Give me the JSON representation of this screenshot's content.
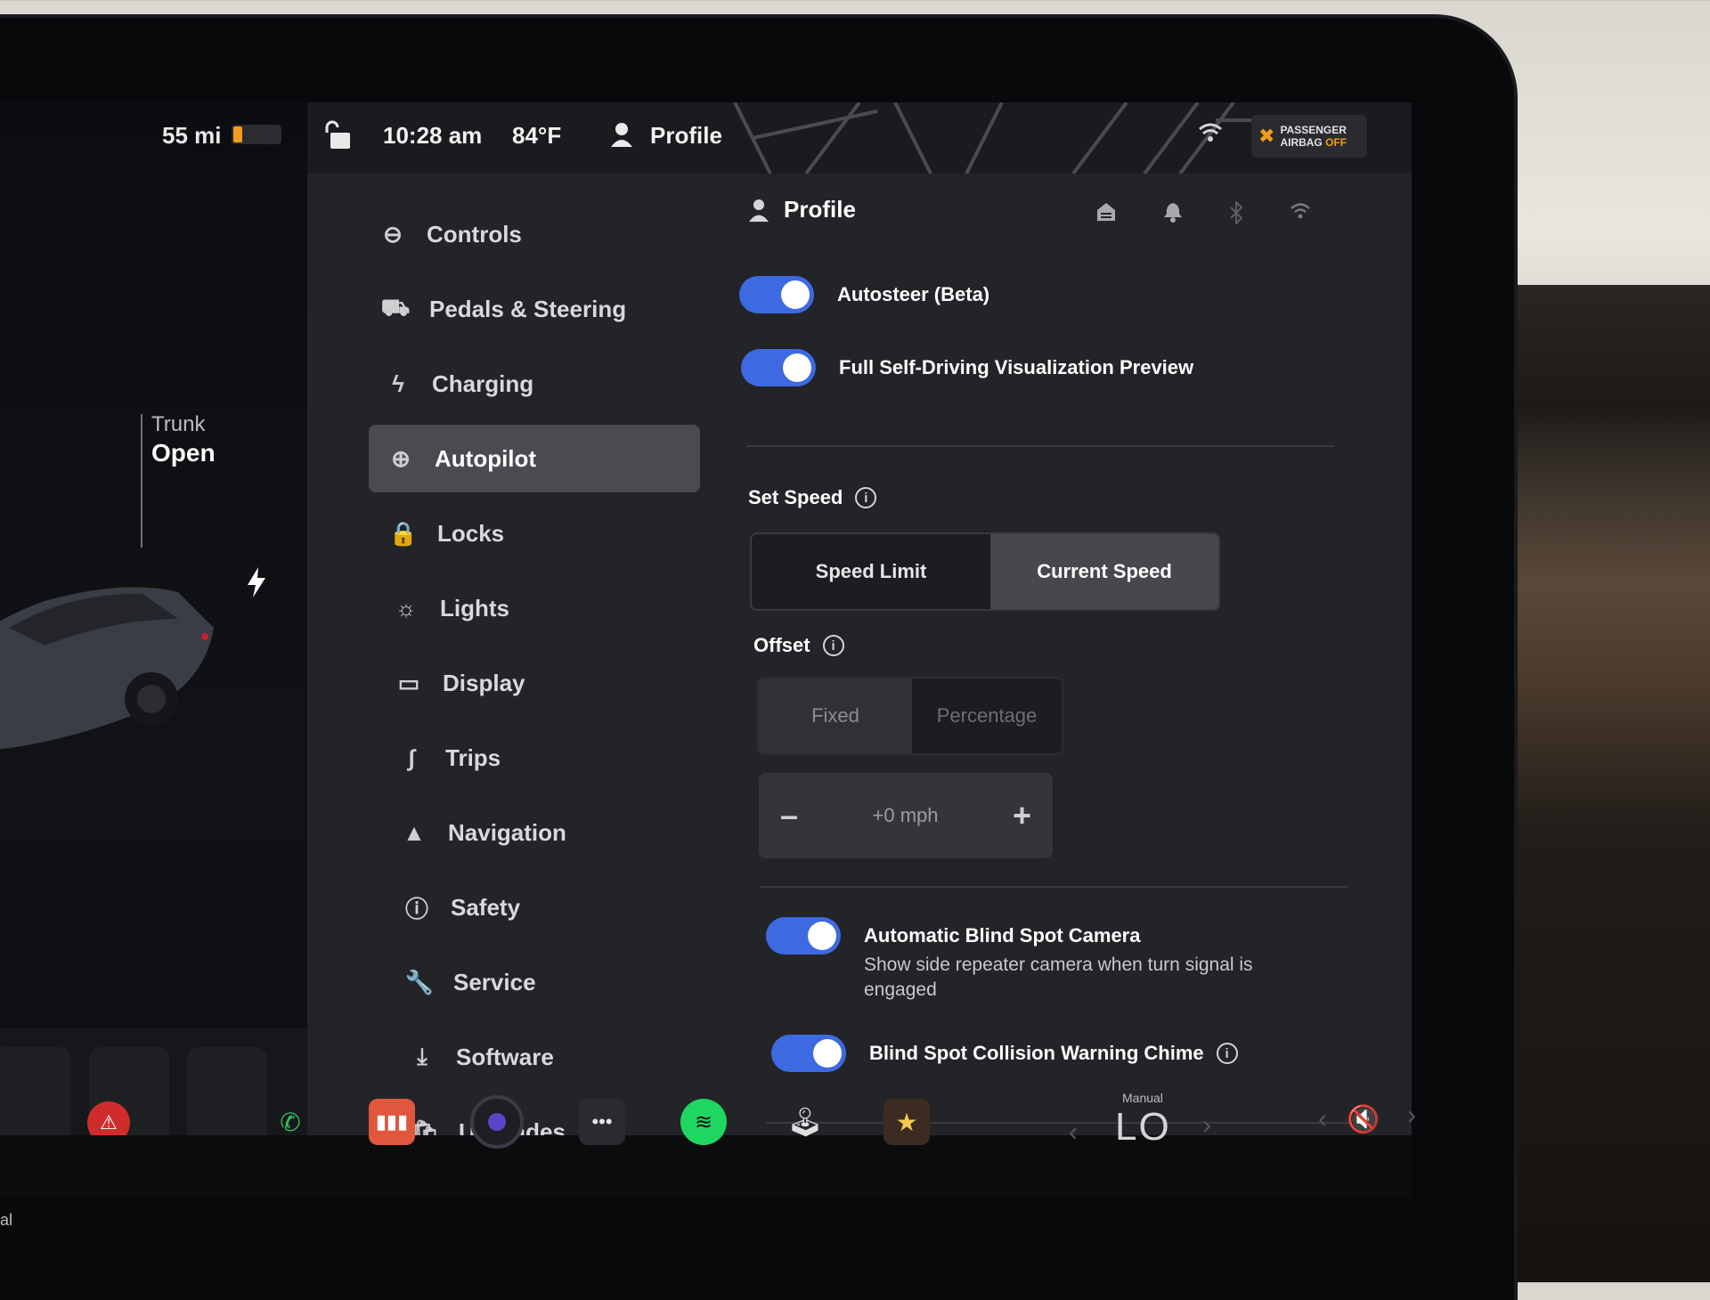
{
  "status": {
    "range": "55 mi",
    "battery_level": 0.2,
    "time": "10:28 am",
    "temperature": "84°F",
    "profile_label": "Profile",
    "airbag_line1": "PASSENGER",
    "airbag_line2": "AIRBAG",
    "airbag_state": "OFF"
  },
  "car": {
    "trunk_label": "Trunk",
    "trunk_value": "Open"
  },
  "nav": {
    "items": [
      {
        "label": "Controls",
        "icon": "toggle-icon"
      },
      {
        "label": "Pedals & Steering",
        "icon": "car-icon"
      },
      {
        "label": "Charging",
        "icon": "bolt-icon"
      },
      {
        "label": "Autopilot",
        "icon": "steering-wheel-icon"
      },
      {
        "label": "Locks",
        "icon": "lock-icon"
      },
      {
        "label": "Lights",
        "icon": "sun-icon"
      },
      {
        "label": "Display",
        "icon": "display-icon"
      },
      {
        "label": "Trips",
        "icon": "trips-icon"
      },
      {
        "label": "Navigation",
        "icon": "navigation-icon"
      },
      {
        "label": "Safety",
        "icon": "alert-icon"
      },
      {
        "label": "Service",
        "icon": "wrench-icon"
      },
      {
        "label": "Software",
        "icon": "download-icon"
      },
      {
        "label": "Upgrades",
        "icon": "bag-icon"
      }
    ],
    "active": "Autopilot"
  },
  "content": {
    "profile_title": "Profile",
    "autosteer_label": "Autosteer (Beta)",
    "autosteer_on": true,
    "fsd_label": "Full Self-Driving Visualization Preview",
    "fsd_on": true,
    "set_speed_title": "Set Speed",
    "set_speed_options": [
      "Speed Limit",
      "Current Speed"
    ],
    "set_speed_selected": "Current Speed",
    "offset_title": "Offset",
    "offset_options": [
      "Fixed",
      "Percentage"
    ],
    "offset_selected": "Fixed",
    "offset_value": "+0 mph",
    "stepper_minus": "–",
    "stepper_plus": "+",
    "blind_spot_camera_label": "Automatic Blind Spot Camera",
    "blind_spot_camera_sub": "Show side repeater camera when turn signal is engaged",
    "blind_spot_camera_on": true,
    "blind_spot_chime_label": "Blind Spot Collision Warning Chime",
    "blind_spot_chime_on": true
  },
  "climate": {
    "mode": "Manual",
    "value": "LO"
  },
  "dock_left_fragment": "al",
  "colors": {
    "accent": "#3e6ae1",
    "alert": "#d12c2c",
    "battery": "#f29c1f"
  }
}
